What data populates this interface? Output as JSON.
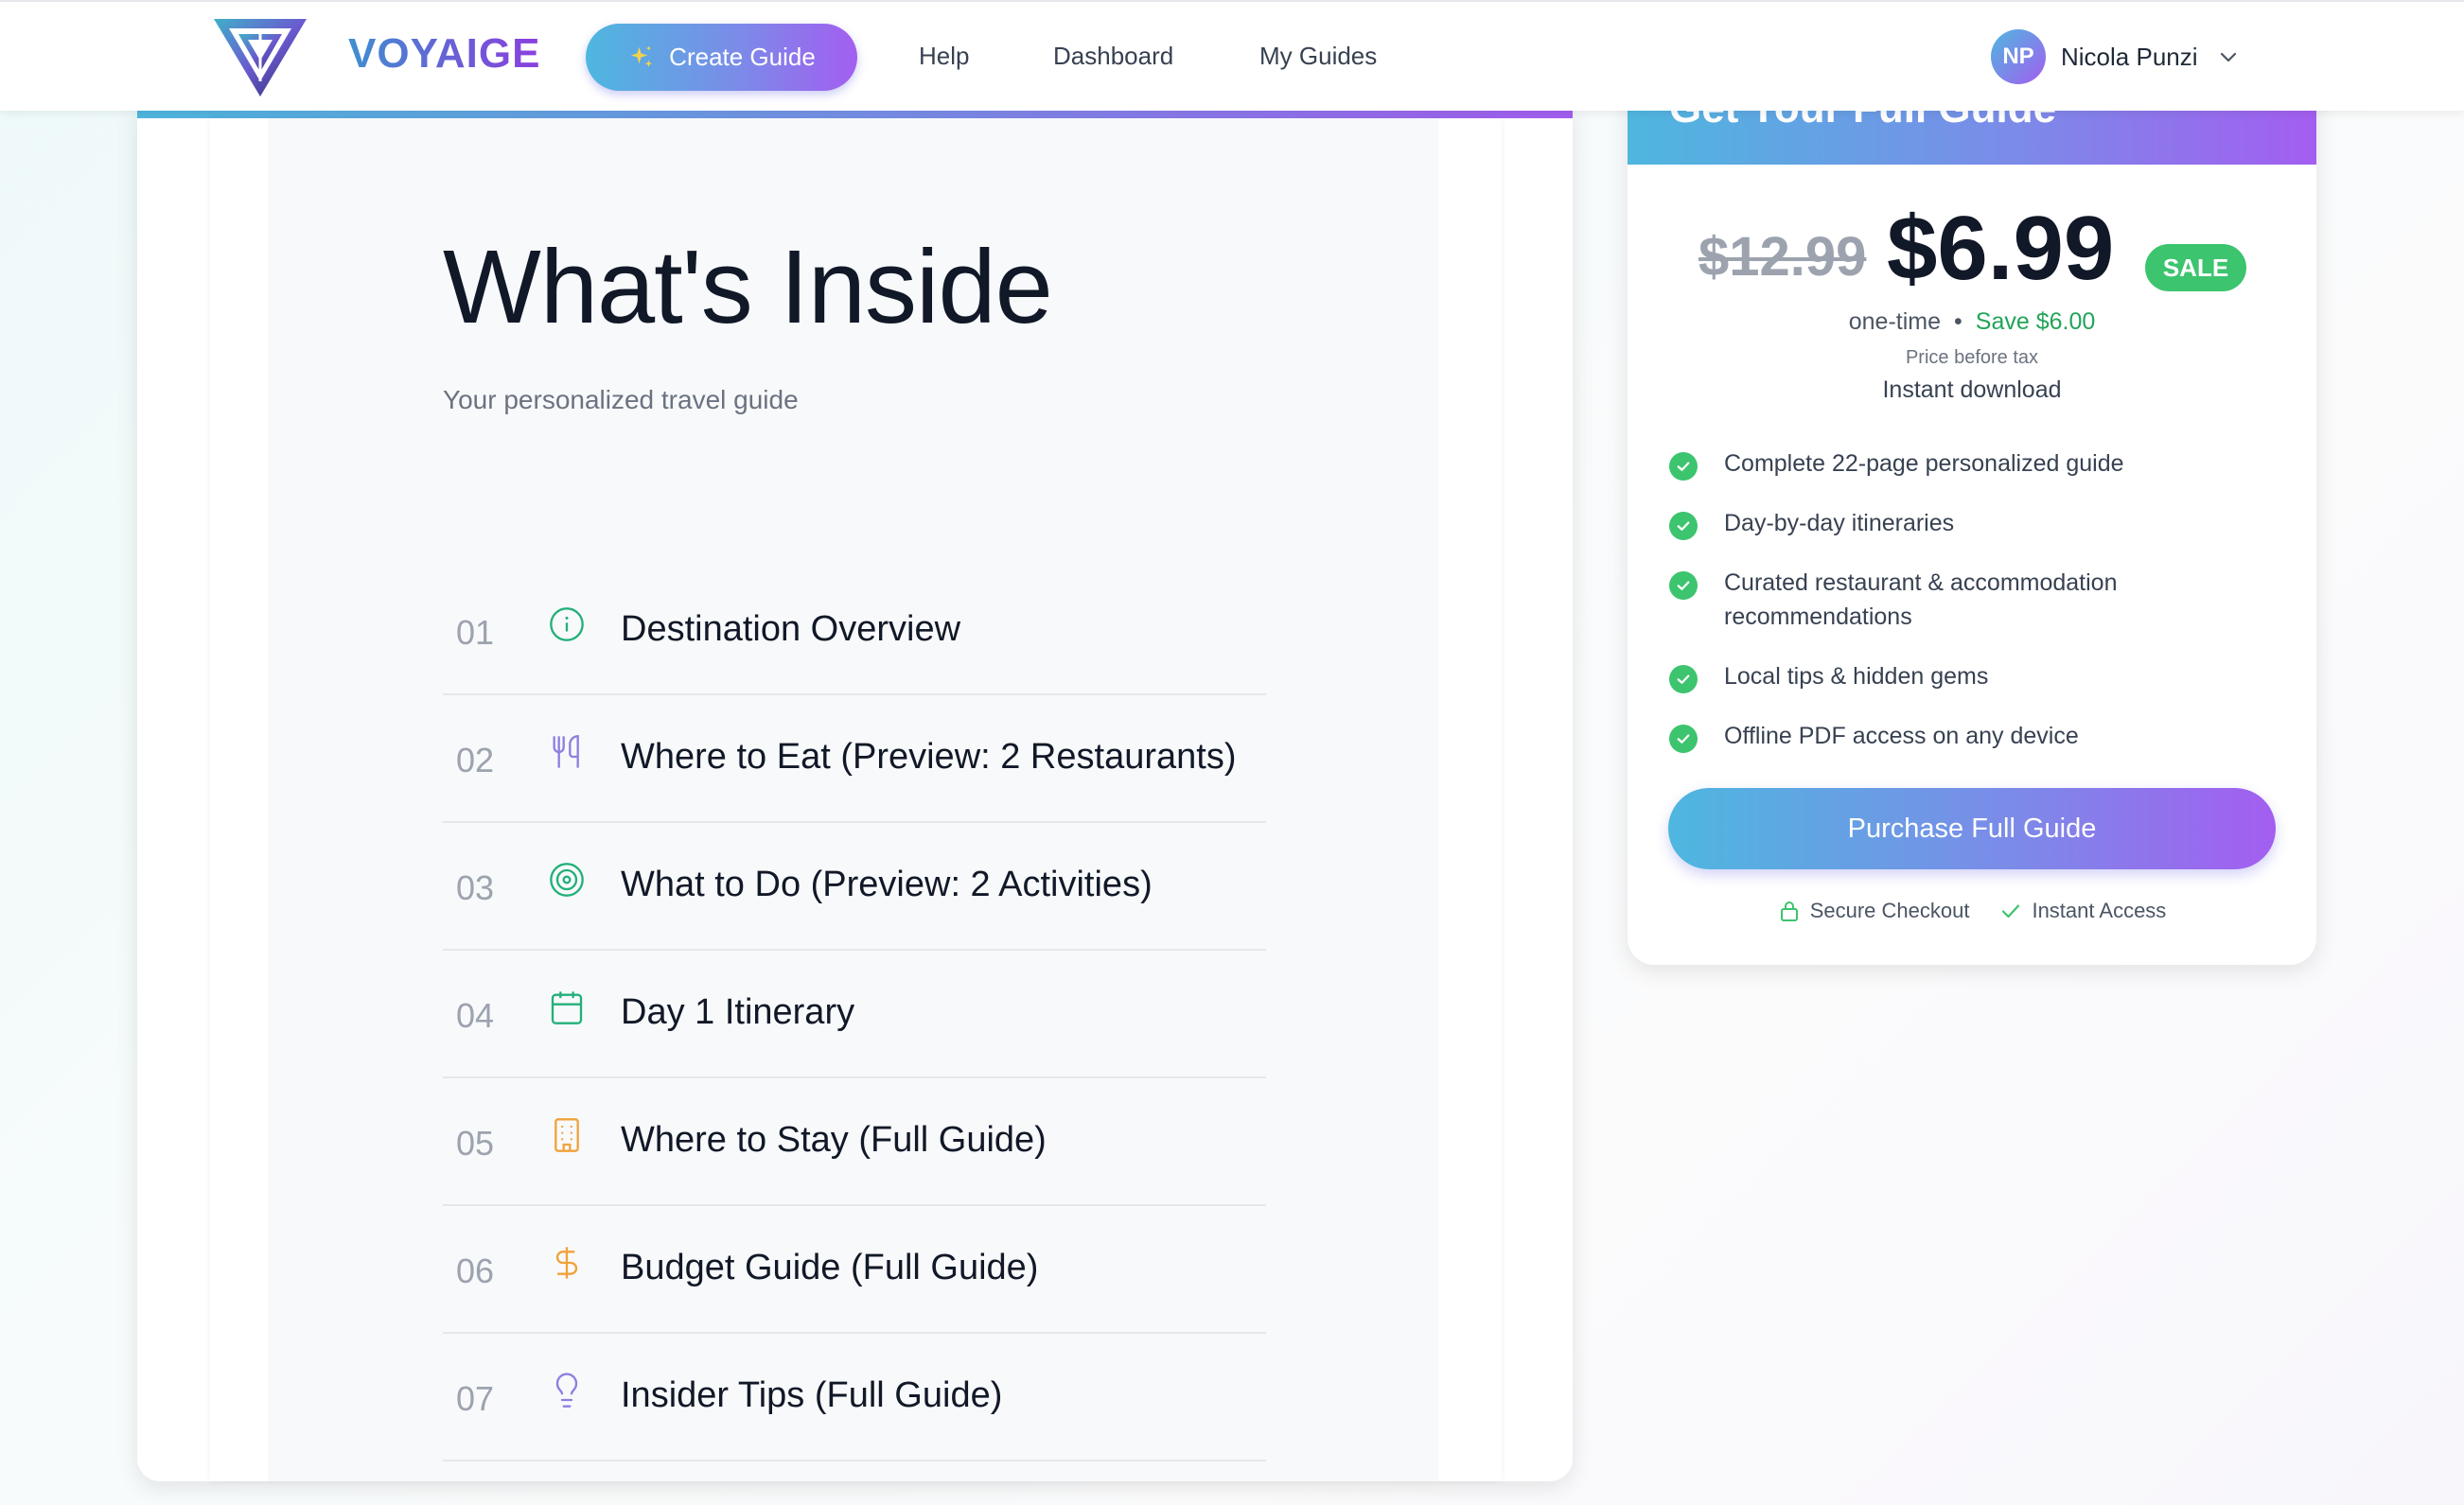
{
  "nav": {
    "brand": "VOYAIGE",
    "create_label": "Create Guide",
    "links": [
      "Help",
      "Dashboard",
      "My Guides"
    ],
    "user_initials": "NP",
    "user_name": "Nicola Punzi"
  },
  "guide": {
    "title": "What's Inside",
    "subtitle": "Your personalized travel guide",
    "sections": [
      {
        "num": "01",
        "icon": "info-icon",
        "label": "Destination Overview",
        "color": "#22b07a"
      },
      {
        "num": "02",
        "icon": "utensils-icon",
        "label": "Where to Eat (Preview: 2 Restaurants)",
        "color": "#8b7fe0"
      },
      {
        "num": "03",
        "icon": "target-icon",
        "label": "What to Do (Preview: 2 Activities)",
        "color": "#22b07a"
      },
      {
        "num": "04",
        "icon": "calendar-icon",
        "label": "Day 1 Itinerary",
        "color": "#22b07a"
      },
      {
        "num": "05",
        "icon": "building-icon",
        "label": "Where to Stay (Full Guide)",
        "color": "#f0a23a"
      },
      {
        "num": "06",
        "icon": "dollar-icon",
        "label": "Budget Guide (Full Guide)",
        "color": "#f0a23a"
      },
      {
        "num": "07",
        "icon": "lightbulb-icon",
        "label": "Insider Tips (Full Guide)",
        "color": "#8b7fe0"
      }
    ]
  },
  "purchase": {
    "heading": "Get Your Full Guide",
    "old_price": "$12.99",
    "price": "$6.99",
    "badge": "SALE",
    "billing": "one-time",
    "save": "Save $6.00",
    "tax_note": "Price before tax",
    "delivery": "Instant download",
    "features": [
      "Complete 22-page personalized guide",
      "Day-by-day itineraries",
      "Curated restaurant & accommodation recommendations",
      "Local tips & hidden gems",
      "Offline PDF access on any device"
    ],
    "cta": "Purchase Full Guide",
    "trust": [
      "Secure Checkout",
      "Instant Access"
    ]
  },
  "colors": {
    "accent_start": "#4eb7df",
    "accent_end": "#a35ef0",
    "success": "#3cc46e"
  }
}
